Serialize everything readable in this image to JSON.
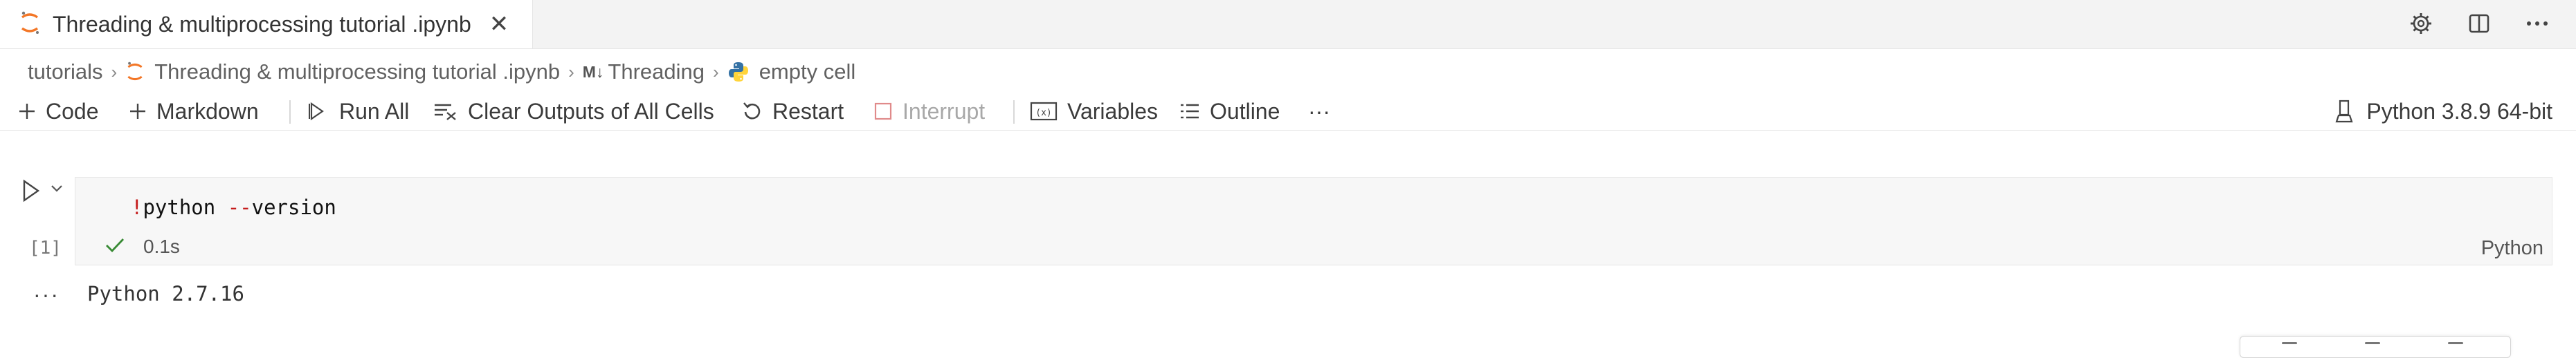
{
  "tab": {
    "title": "Threading & multiprocessing tutorial .ipynb",
    "close_glyph": "✕",
    "icon": "jupyter-icon"
  },
  "editor_actions": [
    "gear-icon",
    "split-editor-icon",
    "more-actions-icon"
  ],
  "breadcrumb": {
    "items": [
      {
        "label": "tutorials",
        "icon": ""
      },
      {
        "label": "Threading & multiprocessing tutorial .ipynb",
        "icon": "jupyter-icon"
      },
      {
        "label": "Threading",
        "icon": "markdown-icon",
        "icon_text": "M↓"
      },
      {
        "label": "empty cell",
        "icon": "python-icon"
      }
    ],
    "separator": "›"
  },
  "toolbar": {
    "code_label": "Code",
    "markdown_label": "Markdown",
    "run_all_label": "Run All",
    "clear_outputs_label": "Clear Outputs of All Cells",
    "restart_label": "Restart",
    "interrupt_label": "Interrupt",
    "variables_label": "Variables",
    "outline_label": "Outline",
    "more_label": "···",
    "kernel_label": "Python 3.8.9 64-bit"
  },
  "cell": {
    "execution_count": "[1]",
    "code_bang": "!",
    "code_cmd": "python ",
    "code_op": "--",
    "code_arg": "version",
    "duration": "0.1s",
    "language": "Python",
    "status": "success"
  },
  "output": {
    "more_label": "···",
    "text": "Python 2.7.16"
  },
  "colors": {
    "accent_jupyter": "#f37626",
    "success": "#388a34",
    "python_blue": "#3572a5",
    "python_yellow": "#ffd43b"
  }
}
